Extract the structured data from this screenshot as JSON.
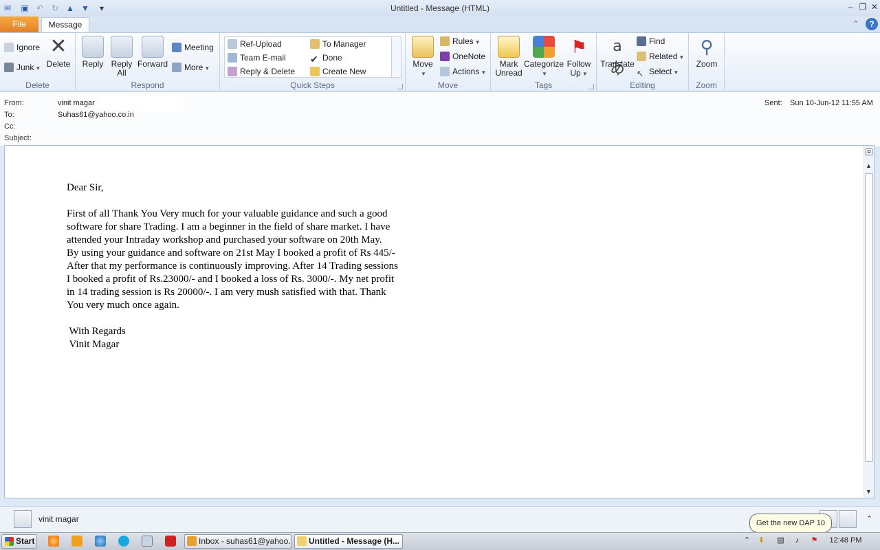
{
  "window": {
    "title": "Untitled  -  Message (HTML)"
  },
  "tabs": {
    "file": "File",
    "message": "Message"
  },
  "ribbon": {
    "delete_group": {
      "label": "Delete",
      "ignore": "Ignore",
      "junk": "Junk",
      "delete": "Delete"
    },
    "respond_group": {
      "label": "Respond",
      "reply": "Reply",
      "reply_all_1": "Reply",
      "reply_all_2": "All",
      "forward": "Forward",
      "meeting": "Meeting",
      "more": "More"
    },
    "quick_steps_group": {
      "label": "Quick Steps",
      "items": [
        "Ref-Upload",
        "To Manager",
        "Team E-mail",
        "Done",
        "Reply & Delete",
        "Create New"
      ]
    },
    "move_group": {
      "label": "Move",
      "move": "Move",
      "rules": "Rules",
      "onenote": "OneNote",
      "actions": "Actions"
    },
    "tags_group": {
      "label": "Tags",
      "mark_unread_1": "Mark",
      "mark_unread_2": "Unread",
      "categorize": "Categorize",
      "follow_up_1": "Follow",
      "follow_up_2": "Up"
    },
    "editing_group": {
      "label": "Editing",
      "translate": "Translate",
      "find": "Find",
      "related": "Related",
      "select": "Select"
    },
    "zoom_group": {
      "label": "Zoom",
      "zoom": "Zoom"
    }
  },
  "header": {
    "from_label": "From:",
    "from_value": "vinit magar",
    "to_label": "To:",
    "to_value": "Suhas61@yahoo.co.in",
    "cc_label": "Cc:",
    "subject_label": "Subject:",
    "sent_label": "Sent:",
    "sent_value": "Sun 10-Jun-12 11:55 AM"
  },
  "body": {
    "greeting": "Dear Sir,",
    "paragraph": [
      "First of all Thank You Very much for your valuable guidance and such a good",
      "software for share Trading. I am a beginner in the field of share market. I have",
      "attended your Intraday workshop and purchased your software on 20th May.",
      "By using your guidance and software on 21st May I booked a profit of Rs 445/-",
      "After that my performance is continuously improving. After 14 Trading sessions",
      "I booked a profit of Rs.23000/-  and I booked  a loss of Rs. 3000/-. My net profit",
      "in 14 trading session is Rs 20000/-. I am very mush satisfied with that. Thank",
      "You very much once again."
    ],
    "closing": " With Regards",
    "signature": " Vinit Magar"
  },
  "people_pane": {
    "name": "vinit magar"
  },
  "tooltip": "Get the new DAP 10",
  "taskbar": {
    "start": "Start",
    "tasks": [
      "Inbox - suhas61@yahoo....",
      "Untitled - Message (H..."
    ],
    "clock": "12:48 PM"
  }
}
